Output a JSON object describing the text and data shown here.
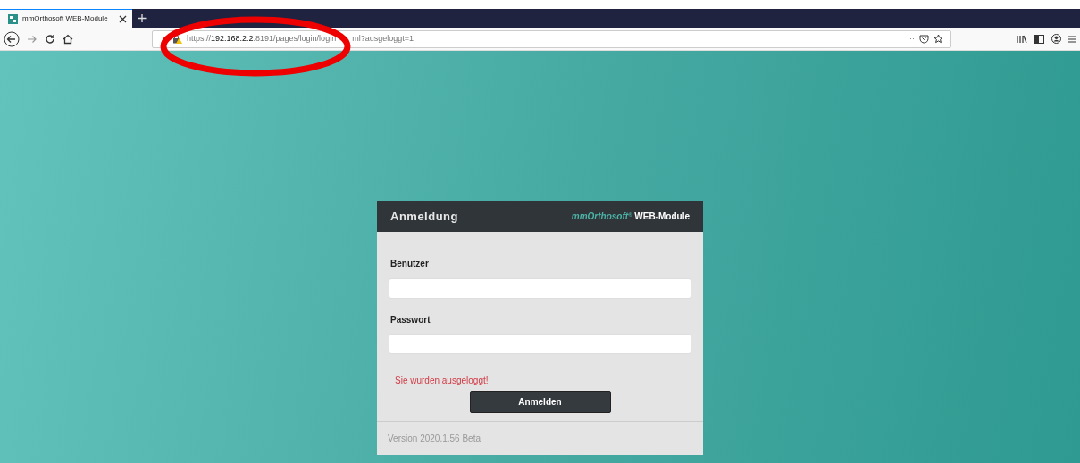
{
  "browser": {
    "tabs": [
      {
        "title": "mmOrthosoft WEB-Module",
        "selected": true
      }
    ],
    "url": {
      "scheme": "https://",
      "host": "192.168.2.2",
      "rest": ":8191/pages/login/login",
      "after_covered": "ml?ausgeloggt=1",
      "insecure": true
    },
    "page_actions": "···"
  },
  "annotation": {
    "kind": "ellipse"
  },
  "login": {
    "title": "Anmeldung",
    "brand": "mmOrthosoft",
    "brand_mark": "®",
    "product": "WEB-Module",
    "fields": [
      {
        "label": "Benutzer"
      },
      {
        "label": "Passwort"
      }
    ],
    "message": "Sie wurden ausgeloggt!",
    "button": "Anmelden",
    "version": "Version 2020.1.56 Beta"
  }
}
